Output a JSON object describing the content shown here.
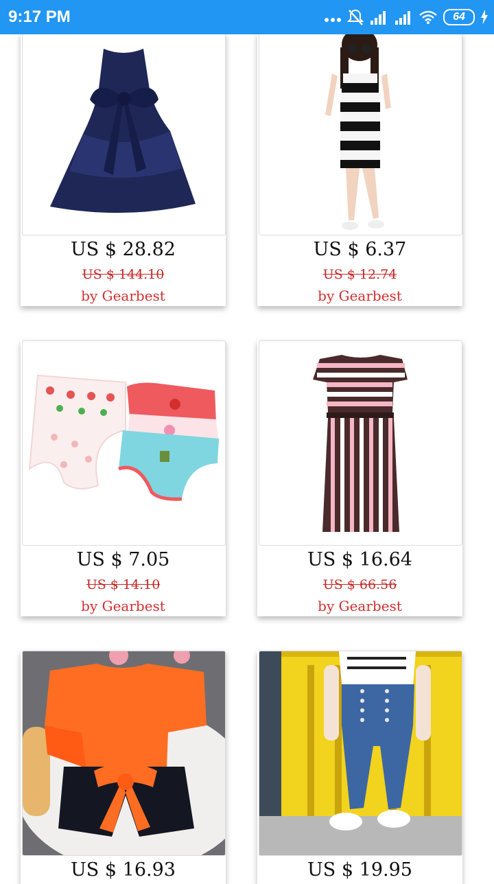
{
  "status_bar": {
    "time": "9:17 PM",
    "battery": "64",
    "icons": [
      "more-dots-icon",
      "alarm-off-icon",
      "signal-icon",
      "signal-icon",
      "wifi-icon",
      "battery-icon",
      "charging-icon"
    ]
  },
  "products": [
    {
      "price": "US $ 28.82",
      "old_price": "US $ 144.10",
      "seller": "by Gearbest",
      "image": "navy-bow-dress"
    },
    {
      "price": "US $ 6.37",
      "old_price": "US $ 12.74",
      "seller": "by Gearbest",
      "image": "striped-bodycon-dress"
    },
    {
      "price": "US $ 7.05",
      "old_price": "US $ 14.10",
      "seller": "by Gearbest",
      "image": "kids-underwear-set"
    },
    {
      "price": "US $ 16.64",
      "old_price": "US $ 66.56",
      "seller": "by Gearbest",
      "image": "striped-maxi-dress"
    },
    {
      "price": "US $ 16.93",
      "image": "orange-top-shorts-set"
    },
    {
      "price": "US $ 19.95",
      "image": "high-waist-jeans"
    }
  ]
}
